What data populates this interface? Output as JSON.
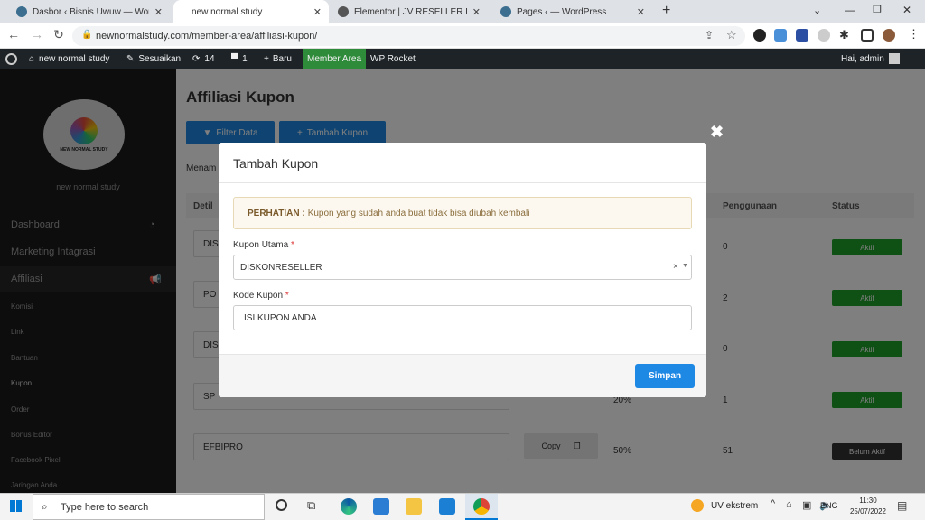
{
  "browser": {
    "tabs": [
      {
        "label": "Dasbor ‹ Bisnis Uwuw — WordPress",
        "active": false,
        "color": "#3c6e8f"
      },
      {
        "label": "new normal study",
        "active": true,
        "color": "#ffffff"
      },
      {
        "label": "Elementor | JV RESELLER HERBAL",
        "active": false,
        "color": "#555555"
      },
      {
        "label": "Pages ‹ — WordPress",
        "active": false,
        "color": "#3c6e8f"
      }
    ],
    "new_tab": "+",
    "url": "newnormalstudy.com/member-area/affiliasi-kupon/"
  },
  "admin_bar": {
    "site_name": "new normal study",
    "customize": "Sesuaikan",
    "updates": "14",
    "comments": "1",
    "new": "Baru",
    "member_area": "Member Area",
    "wp_rocket": "WP Rocket",
    "greeting": "Hai, admin"
  },
  "sidebar": {
    "logo_text": "NEW NORMAL STUDY",
    "site_name": "new normal study",
    "items": [
      {
        "label": "Dashboard"
      },
      {
        "label": "Marketing Intagrasi"
      },
      {
        "label": "Affiliasi"
      },
      {
        "label": "Komisi"
      },
      {
        "label": "Link"
      },
      {
        "label": "Bantuan"
      },
      {
        "label": "Kupon"
      },
      {
        "label": "Order"
      },
      {
        "label": "Bonus Editor"
      },
      {
        "label": "Facebook Pixel"
      },
      {
        "label": "Jaringan Anda"
      }
    ]
  },
  "main": {
    "title": "Affiliasi Kupon",
    "filter_btn": "Filter Data",
    "add_btn": "Tambah Kupon",
    "menampilkan": "Menam",
    "columns": {
      "detil": "Detil",
      "penggunaan": "Penggunaan",
      "status": "Status"
    },
    "rows": [
      {
        "code": "DIS",
        "percent": "",
        "usage": "0",
        "status": "Aktif"
      },
      {
        "code": "PO",
        "percent": "",
        "usage": "2",
        "status": "Aktif"
      },
      {
        "code": "DIS",
        "percent": "",
        "usage": "0",
        "status": "Aktif"
      },
      {
        "code": "SP",
        "percent": "20%",
        "usage": "1",
        "status": "Aktif"
      },
      {
        "code": "EFBIPRO",
        "percent": "50%",
        "usage": "51",
        "status": "Belum Aktif"
      }
    ],
    "copy_label": "Copy"
  },
  "modal": {
    "title": "Tambah Kupon",
    "alert_strong": "PERHATIAN :",
    "alert_text": "Kupon yang sudah anda buat tidak bisa diubah kembali",
    "field1_label": "Kupon Utama",
    "field1_value": "DISKONRESELLER",
    "field2_label": "Kode Kupon",
    "field2_value": "ISI KUPON ANDA",
    "required_mark": "*",
    "save_label": "Simpan",
    "close": "✖"
  },
  "taskbar": {
    "search_placeholder": "Type here to search",
    "tray_app": "UV ekstrem",
    "lang": "ENG",
    "time": "11:30",
    "date": "25/07/2022"
  },
  "colors": {
    "member_area": "#2e8b3a",
    "primary": "#1e88e5",
    "active_badge": "#1fa12a",
    "inactive_badge": "#333333"
  }
}
